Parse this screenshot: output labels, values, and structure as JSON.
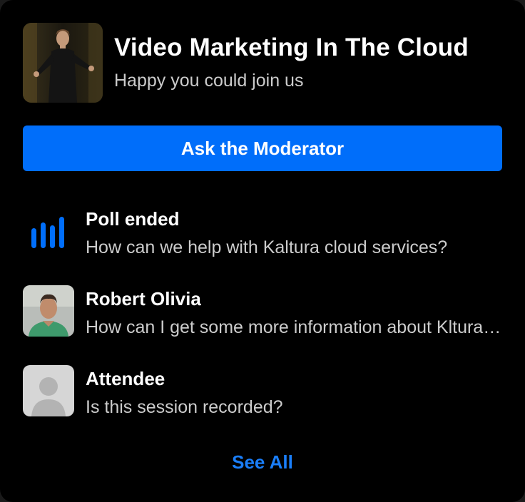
{
  "session": {
    "title": "Video Marketing In The Cloud",
    "subtitle": "Happy you could join us",
    "thumbnail_icon": "presenter-thumbnail"
  },
  "actions": {
    "ask_label": "Ask the Moderator",
    "see_all_label": "See All"
  },
  "colors": {
    "accent": "#006efa",
    "background": "#000000",
    "link": "#1a7ef9"
  },
  "feed": [
    {
      "icon": "poll-icon",
      "name": "Poll ended",
      "message": "How can we help with Kaltura cloud services?"
    },
    {
      "icon": "avatar-photo",
      "name": "Robert Olivia",
      "message": "How can I get some more information about Kltura services and pricing?"
    },
    {
      "icon": "default-avatar-icon",
      "name": "Attendee",
      "message": "Is this session recorded?"
    }
  ]
}
